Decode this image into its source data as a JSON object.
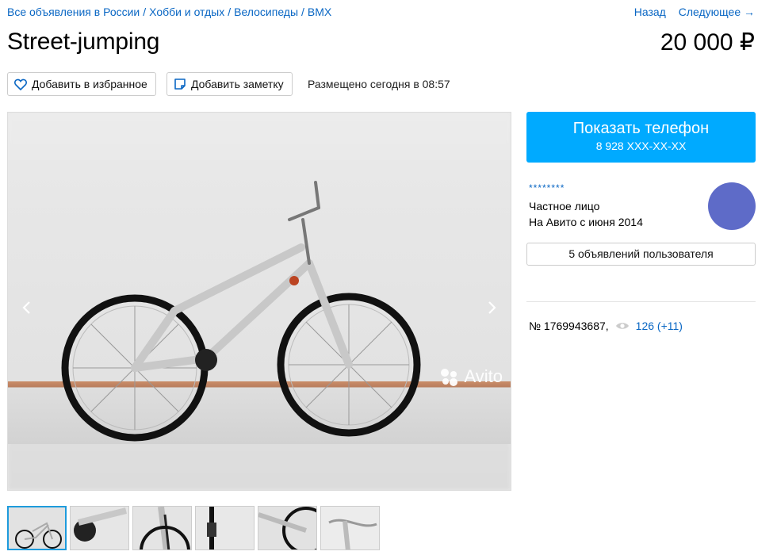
{
  "breadcrumb": {
    "items": [
      "Все объявления в России",
      "Хобби и отдых",
      "Велосипеды",
      "BMX"
    ],
    "separator": "/"
  },
  "nav": {
    "back": "Назад",
    "next": "Следующее →"
  },
  "listing": {
    "title": "Street-jumping",
    "price": "20 000 ₽",
    "posted": "Размещено сегодня в 08:57",
    "number": "№ 1769943687,",
    "views": "126 (+11)"
  },
  "actions": {
    "favorite": "Добавить в избранное",
    "note": "Добавить заметку"
  },
  "gallery": {
    "watermark": "Avito",
    "prev_icon": "chevron-left-icon",
    "next_icon": "chevron-right-icon",
    "thumbnails": 6
  },
  "contact": {
    "phone_label": "Показать телефон",
    "phone_masked": "8 928 XXX-XX-XX"
  },
  "seller": {
    "name": "********",
    "type": "Частное лицо",
    "since": "На Авито с июня 2014",
    "ads_button": "5 объявлений пользователя",
    "avatar_color": "#5e6bc8"
  },
  "colors": {
    "link": "#0a67c4",
    "accent": "#00aaff"
  }
}
